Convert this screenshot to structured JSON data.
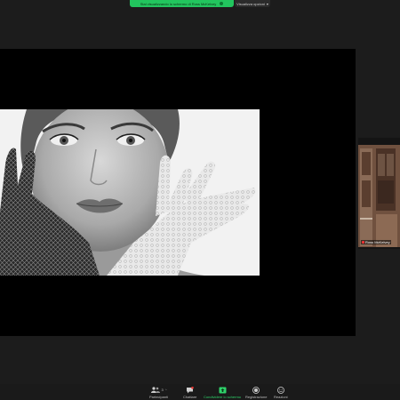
{
  "banner": {
    "share_status": "Stai visualizzando lo schermo di Ross McKelvey",
    "view_options": "Visualizza opzioni"
  },
  "thumbnail": {
    "name": "Ross McKelvey"
  },
  "toolbar": {
    "participants_label": "Partecipanti",
    "participants_count": "3",
    "chat_label": "Chattare",
    "share_label": "Condividere lo schermo",
    "record_label": "Registrazione",
    "reactions_label": "Reazioni"
  },
  "colors": {
    "share_green": "#22c55e",
    "background": "#1c1c1c",
    "stage": "#000000"
  }
}
